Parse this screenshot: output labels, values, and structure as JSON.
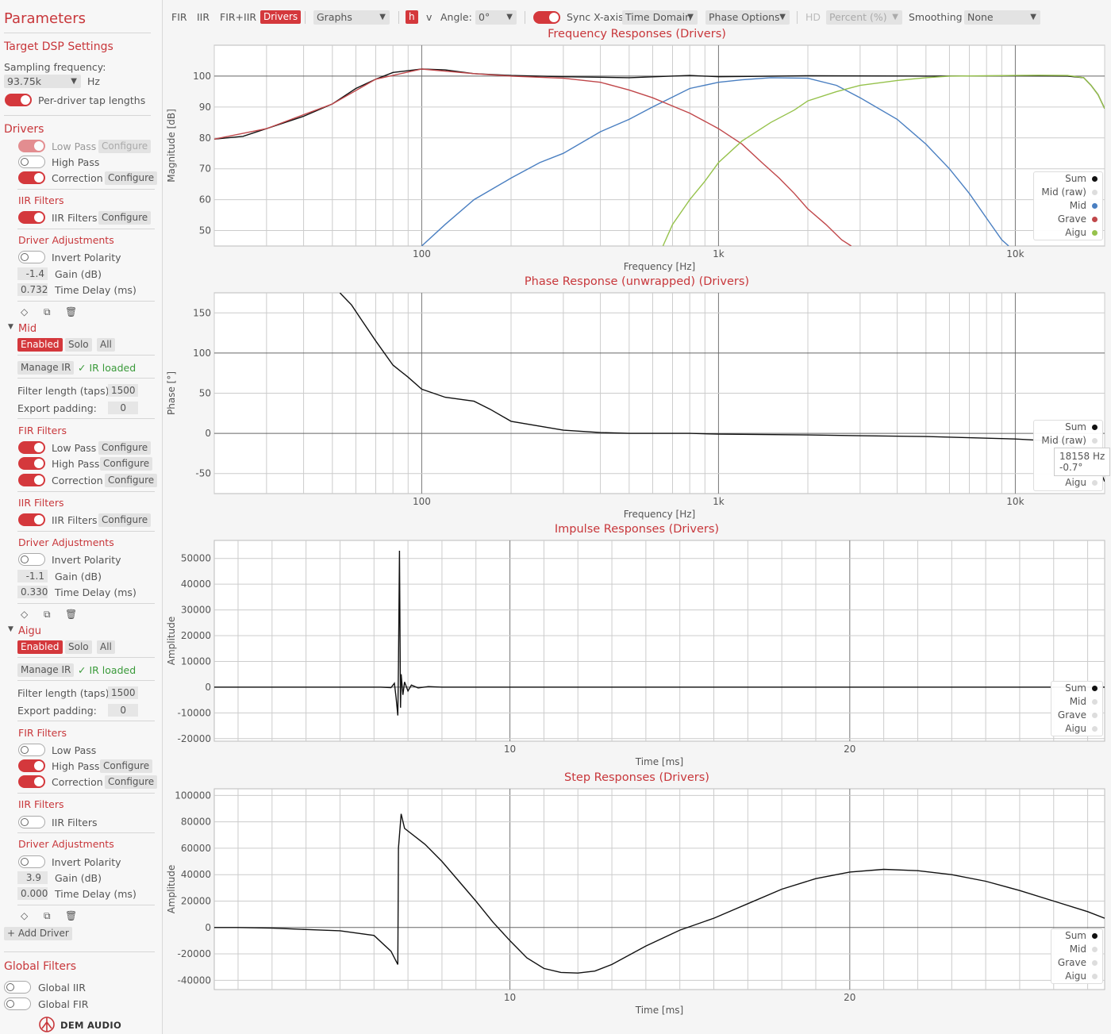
{
  "sidebar": {
    "title": "Parameters",
    "target": {
      "heading": "Target DSP Settings",
      "sampling_label": "Sampling frequency:",
      "sampling_value": "93.75k",
      "sampling_unit": "Hz",
      "per_driver_label": "Per-driver tap lengths"
    },
    "drivers_heading": "Drivers",
    "grave": {
      "lowpass_label": "Low Pass",
      "lowpass_config": "Configure",
      "highpass_label": "High Pass",
      "correction_label": "Correction",
      "correction_config": "Configure",
      "iir_heading": "IIR Filters",
      "iir_label": "IIR Filters",
      "iir_config": "Configure",
      "adj_heading": "Driver Adjustments",
      "invert_label": "Invert Polarity",
      "gain_value": "-1.4",
      "gain_label": "Gain (dB)",
      "delay_value": "0.732",
      "delay_label": "Time Delay (ms)"
    },
    "mid": {
      "name": "Mid",
      "enabled": "Enabled",
      "solo": "Solo",
      "all": "All",
      "manage_ir": "Manage IR",
      "ir_status": "✓ IR loaded",
      "filter_len_label": "Filter length (taps):",
      "filter_len_value": "1500",
      "export_pad_label": "Export padding:",
      "export_pad_value": "0",
      "fir_heading": "FIR Filters",
      "lowpass_label": "Low Pass",
      "lowpass_config": "Configure",
      "highpass_label": "High Pass",
      "highpass_config": "Configure",
      "correction_label": "Correction",
      "correction_config": "Configure",
      "iir_heading": "IIR Filters",
      "iir_label": "IIR Filters",
      "iir_config": "Configure",
      "adj_heading": "Driver Adjustments",
      "invert_label": "Invert Polarity",
      "gain_value": "-1.1",
      "gain_label": "Gain (dB)",
      "delay_value": "0.330",
      "delay_label": "Time Delay (ms)"
    },
    "aigu": {
      "name": "Aigu",
      "enabled": "Enabled",
      "solo": "Solo",
      "all": "All",
      "manage_ir": "Manage IR",
      "ir_status": "✓ IR loaded",
      "filter_len_label": "Filter length (taps):",
      "filter_len_value": "1500",
      "export_pad_label": "Export padding:",
      "export_pad_value": "0",
      "fir_heading": "FIR Filters",
      "lowpass_label": "Low Pass",
      "highpass_label": "High Pass",
      "highpass_config": "Configure",
      "correction_label": "Correction",
      "correction_config": "Configure",
      "iir_heading": "IIR Filters",
      "iir_label": "IIR Filters",
      "adj_heading": "Driver Adjustments",
      "invert_label": "Invert Polarity",
      "gain_value": "3.9",
      "gain_label": "Gain (dB)",
      "delay_value": "0.000",
      "delay_label": "Time Delay (ms)"
    },
    "add_driver": "+ Add Driver",
    "global": {
      "heading": "Global Filters",
      "iir_label": "Global IIR",
      "fir_label": "Global FIR"
    },
    "brand": "DEM AUDIO"
  },
  "toolbar": {
    "fir": "FIR",
    "iir": "IIR",
    "fir_iir": "FIR+IIR",
    "drivers": "Drivers",
    "graphs": "Graphs",
    "h": "h",
    "v": "v",
    "angle_label": "Angle:",
    "angle_value": "0°",
    "sync_label": "Sync X-axis",
    "time_domain": "Time Domain",
    "phase_options": "Phase Options",
    "hd": "HD",
    "percent": "Percent (%)",
    "smoothing_label": "Smoothing",
    "smoothing_value": "None"
  },
  "colors": {
    "accent": "#c8373b",
    "sum": "#111111",
    "mid": "#4a7fc1",
    "grave": "#c0474a",
    "aigu": "#96c24c",
    "inactive": "#dddddd"
  },
  "chart_data": [
    {
      "type": "line",
      "title": "Frequency Responses (Drivers)",
      "xlabel": "Frequency [Hz]",
      "ylabel": "Magnitude [dB]",
      "xscale": "log",
      "xlim": [
        20,
        20000
      ],
      "ylim": [
        45,
        110
      ],
      "xticks": [
        "100",
        "1k",
        "10k"
      ],
      "yticks": [
        50,
        60,
        70,
        80,
        90,
        100
      ],
      "grid": true,
      "legend_position": "bottom-right",
      "legend": [
        "Sum",
        "Mid (raw)",
        "Mid",
        "Grave",
        "Aigu"
      ],
      "series": [
        {
          "name": "Sum",
          "color": "#111111",
          "points": [
            [
              20,
              79.6
            ],
            [
              25,
              80.5
            ],
            [
              30,
              83
            ],
            [
              40,
              87
            ],
            [
              50,
              91
            ],
            [
              60,
              96
            ],
            [
              70,
              99
            ],
            [
              80,
              101.2
            ],
            [
              100,
              102.3
            ],
            [
              120,
              102
            ],
            [
              150,
              100.8
            ],
            [
              200,
              100.2
            ],
            [
              300,
              99.8
            ],
            [
              500,
              99.5
            ],
            [
              800,
              100.2
            ],
            [
              1000,
              99.8
            ],
            [
              2000,
              100.1
            ],
            [
              5000,
              100
            ],
            [
              10000,
              100.1
            ],
            [
              15000,
              100
            ],
            [
              17000,
              99.5
            ],
            [
              18000,
              97
            ],
            [
              19000,
              94
            ],
            [
              20000,
              89.5
            ]
          ]
        },
        {
          "name": "Mid",
          "color": "#4a7fc1",
          "points": [
            [
              100,
              45
            ],
            [
              120,
              52
            ],
            [
              150,
              60
            ],
            [
              200,
              67
            ],
            [
              250,
              72
            ],
            [
              300,
              75
            ],
            [
              400,
              82
            ],
            [
              500,
              86
            ],
            [
              600,
              90
            ],
            [
              800,
              96
            ],
            [
              1000,
              98
            ],
            [
              1200,
              98.8
            ],
            [
              1500,
              99.5
            ],
            [
              2000,
              99.3
            ],
            [
              2500,
              97
            ],
            [
              3000,
              93
            ],
            [
              4000,
              86
            ],
            [
              5000,
              78
            ],
            [
              6000,
              70
            ],
            [
              7000,
              62
            ],
            [
              8000,
              54
            ],
            [
              9000,
              47
            ],
            [
              9500,
              45
            ]
          ]
        },
        {
          "name": "Grave",
          "color": "#c0474a",
          "points": [
            [
              20,
              79.6
            ],
            [
              30,
              83
            ],
            [
              50,
              91
            ],
            [
              70,
              99
            ],
            [
              100,
              102.3
            ],
            [
              150,
              100.8
            ],
            [
              200,
              100
            ],
            [
              300,
              99.3
            ],
            [
              400,
              98
            ],
            [
              500,
              95.5
            ],
            [
              600,
              93
            ],
            [
              800,
              88
            ],
            [
              1000,
              83
            ],
            [
              1200,
              78
            ],
            [
              1400,
              72
            ],
            [
              1600,
              67
            ],
            [
              1800,
              62
            ],
            [
              2000,
              57
            ],
            [
              2300,
              52
            ],
            [
              2600,
              47
            ],
            [
              2800,
              45
            ]
          ]
        },
        {
          "name": "Aigu",
          "color": "#96c24c",
          "points": [
            [
              650,
              45
            ],
            [
              700,
              52
            ],
            [
              800,
              60
            ],
            [
              900,
              66
            ],
            [
              1000,
              72
            ],
            [
              1200,
              79
            ],
            [
              1500,
              85
            ],
            [
              1800,
              89
            ],
            [
              2000,
              92
            ],
            [
              2500,
              95
            ],
            [
              3000,
              97
            ],
            [
              4000,
              98.6
            ],
            [
              5000,
              99.5
            ],
            [
              6000,
              100
            ],
            [
              8000,
              100.1
            ],
            [
              10000,
              100.2
            ],
            [
              12000,
              100.3
            ],
            [
              15000,
              100.2
            ],
            [
              17000,
              99.5
            ],
            [
              18000,
              97
            ],
            [
              19000,
              94
            ],
            [
              20000,
              89.5
            ]
          ]
        }
      ]
    },
    {
      "type": "line",
      "title": "Phase Response (unwrapped) (Drivers)",
      "xlabel": "Frequency [Hz]",
      "ylabel": "Phase [°]",
      "xscale": "log",
      "xlim": [
        20,
        20000
      ],
      "ylim": [
        -75,
        175
      ],
      "xticks": [
        "100",
        "1k",
        "10k"
      ],
      "yticks": [
        -50,
        0,
        50,
        100,
        150
      ],
      "grid": true,
      "legend_position": "right",
      "legend": [
        "Sum",
        "Mid (raw)",
        "Aigu"
      ],
      "tooltip": {
        "freq": "18158 Hz",
        "value": "-0.7°"
      },
      "series": [
        {
          "name": "Sum",
          "color": "#111111",
          "points": [
            [
              53,
              175
            ],
            [
              58,
              160
            ],
            [
              63,
              140
            ],
            [
              70,
              115
            ],
            [
              80,
              85
            ],
            [
              90,
              70
            ],
            [
              100,
              55
            ],
            [
              120,
              45
            ],
            [
              150,
              40
            ],
            [
              170,
              30
            ],
            [
              200,
              15
            ],
            [
              300,
              4
            ],
            [
              400,
              1
            ],
            [
              500,
              0
            ],
            [
              800,
              0
            ],
            [
              1000,
              -1
            ],
            [
              2000,
              -2
            ],
            [
              3000,
              -3
            ],
            [
              5000,
              -4
            ],
            [
              10000,
              -7
            ],
            [
              14000,
              -10
            ],
            [
              18000,
              -25
            ],
            [
              19000,
              -40
            ],
            [
              20000,
              -60
            ]
          ]
        }
      ]
    },
    {
      "type": "line",
      "title": "Impulse Responses (Drivers)",
      "xlabel": "Time [ms]",
      "ylabel": "Amplitude",
      "xlim": [
        1.3,
        27.5
      ],
      "ylim": [
        -21000,
        57000
      ],
      "xticks": [
        10,
        20
      ],
      "yticks": [
        -20000,
        -10000,
        0,
        10000,
        20000,
        30000,
        40000,
        50000
      ],
      "grid": true,
      "legend_position": "bottom-right",
      "legend": [
        "Sum",
        "Mid",
        "Grave",
        "Aigu"
      ],
      "series": [
        {
          "name": "Sum",
          "color": "#111111",
          "points": [
            [
              1.3,
              0
            ],
            [
              6.2,
              0
            ],
            [
              6.5,
              -200
            ],
            [
              6.6,
              1500
            ],
            [
              6.65,
              -4000
            ],
            [
              6.7,
              -11000
            ],
            [
              6.72,
              8000
            ],
            [
              6.75,
              53000
            ],
            [
              6.78,
              -8000
            ],
            [
              6.8,
              5000
            ],
            [
              6.85,
              -3000
            ],
            [
              6.9,
              2000
            ],
            [
              7.0,
              -1500
            ],
            [
              7.1,
              800
            ],
            [
              7.3,
              -300
            ],
            [
              7.6,
              200
            ],
            [
              8,
              0
            ],
            [
              27.5,
              0
            ]
          ]
        }
      ]
    },
    {
      "type": "line",
      "title": "Step Responses (Drivers)",
      "xlabel": "Time [ms]",
      "ylabel": "Amplitude",
      "xlim": [
        1.3,
        27.5
      ],
      "ylim": [
        -47000,
        105000
      ],
      "xticks": [
        10,
        20
      ],
      "yticks": [
        -40000,
        -20000,
        0,
        20000,
        40000,
        60000,
        80000,
        100000
      ],
      "grid": true,
      "legend_position": "bottom-right",
      "legend": [
        "Sum",
        "Mid",
        "Grave",
        "Aigu"
      ],
      "series": [
        {
          "name": "Sum",
          "color": "#111111",
          "points": [
            [
              1.3,
              0
            ],
            [
              2,
              0
            ],
            [
              3,
              -500
            ],
            [
              4,
              -1500
            ],
            [
              5,
              -2500
            ],
            [
              6,
              -6000
            ],
            [
              6.5,
              -18000
            ],
            [
              6.7,
              -28000
            ],
            [
              6.72,
              60000
            ],
            [
              6.8,
              86000
            ],
            [
              6.9,
              75000
            ],
            [
              7.5,
              63000
            ],
            [
              8,
              50000
            ],
            [
              8.5,
              35000
            ],
            [
              9,
              20000
            ],
            [
              9.5,
              4000
            ],
            [
              10,
              -10000
            ],
            [
              10.5,
              -23000
            ],
            [
              11,
              -31000
            ],
            [
              11.5,
              -34000
            ],
            [
              12,
              -34500
            ],
            [
              12.5,
              -33000
            ],
            [
              13,
              -28000
            ],
            [
              14,
              -14000
            ],
            [
              15,
              -2000
            ],
            [
              16,
              7000
            ],
            [
              17,
              18000
            ],
            [
              18,
              29000
            ],
            [
              19,
              37000
            ],
            [
              20,
              42000
            ],
            [
              21,
              44000
            ],
            [
              22,
              43000
            ],
            [
              23,
              40000
            ],
            [
              24,
              35000
            ],
            [
              25,
              28000
            ],
            [
              26,
              20000
            ],
            [
              27,
              12000
            ],
            [
              27.5,
              7000
            ]
          ]
        }
      ]
    }
  ]
}
